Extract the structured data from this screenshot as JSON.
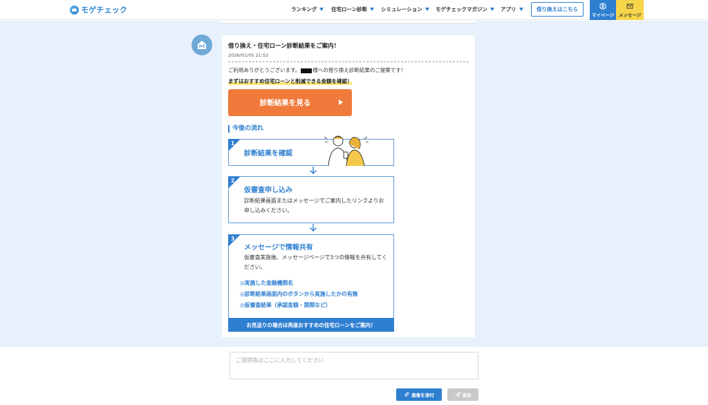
{
  "header": {
    "logo": "モゲチェック",
    "nav": [
      {
        "label": "ランキング"
      },
      {
        "label": "住宅ローン診断"
      },
      {
        "label": "シミュレーション"
      },
      {
        "label": "モゲチェックマガジン"
      },
      {
        "label": "アプリ"
      }
    ],
    "refinance_button": "借り換えはこちら",
    "mypage": "マイページ",
    "message": "メッセージ"
  },
  "message": {
    "title": "借り換え・住宅ローン診断結果をご案内！",
    "date": "2026/01/05 21:52",
    "body_pre": "ご利用ありがとうございます。",
    "body_post": "様への借り換え診断結果のご提案です！",
    "highlight": "まずはおすすめ住宅ローンと削減できる金額を確認！",
    "cta": "診断結果を見る",
    "flow_heading": "今後の流れ",
    "steps": [
      {
        "num": "1",
        "title": "診断結果を確認"
      },
      {
        "num": "2",
        "title": "仮審査申し込み",
        "text": "診断結果画面またはメッセージでご案内したリンクよりお申し込みください。"
      },
      {
        "num": "3",
        "title": "メッセージで情報共有",
        "text": "仮審査実施後、メッセージページで3つの情報を共有してください。",
        "bullets": [
          "◎実施した金融機関名",
          "◎診断結果画面内のボタンから実施したかの有無",
          "◎仮審査結果（承認金額・期間など）"
        ],
        "footer": "お見送りの場合は再度おすすめの住宅ローンをご案内！"
      }
    ]
  },
  "composer": {
    "placeholder": "ご質問等はここに入力してください",
    "attach": "画像を添付",
    "send": "送信"
  },
  "colors": {
    "primary": "#2f7fd1",
    "cta": "#ef7a3b",
    "content_bg": "#e8f1fb",
    "message_tab": "#f7d54a"
  }
}
